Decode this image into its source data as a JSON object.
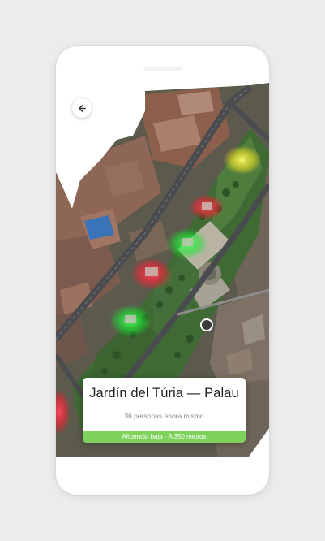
{
  "place": {
    "name": "Jardín del Túria — Palau",
    "people_now": "36 personas ahora mismo",
    "status": "Afluencia baja - A 350 metros"
  },
  "icons": {
    "back": "arrow-left-icon",
    "user_location": "location-marker-icon"
  },
  "colors": {
    "background": "#ececec",
    "status_bar": "#7ed25a",
    "heat_red": "#ff2a3c",
    "heat_green": "#2dff3e",
    "heat_yellow": "#fff02a"
  }
}
